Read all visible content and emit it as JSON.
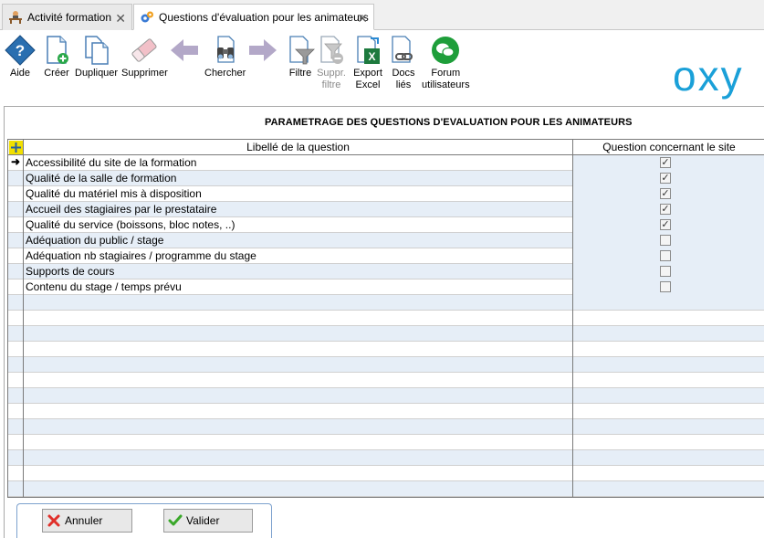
{
  "tabs": [
    {
      "label": "Activité formation",
      "icon": "classroom-icon",
      "active": false
    },
    {
      "label": "Questions d'évaluation pour les animateurs",
      "icon": "gears-icon",
      "active": true
    }
  ],
  "toolbar": {
    "aide": "Aide",
    "creer": "Créer",
    "dupliquer": "Dupliquer",
    "supprimer": "Supprimer",
    "chercher": "Chercher",
    "filtre": "Filtre",
    "suppr_filtre_1": "Suppr.",
    "suppr_filtre_2": "filtre",
    "export_1": "Export",
    "export_2": "Excel",
    "docs_1": "Docs",
    "docs_2": "liés",
    "forum_1": "Forum",
    "forum_2": "utilisateurs"
  },
  "logo": "oxy",
  "page_title": "PARAMETRAGE DES QUESTIONS D'EVALUATION POUR LES ANIMATEURS",
  "grid": {
    "columns": [
      "Libellé de la question",
      "Question concernant le site"
    ],
    "rows": [
      {
        "label": "Accessibilité du site de la formation",
        "checked": true,
        "current": true
      },
      {
        "label": "Qualité de la salle de formation",
        "checked": true
      },
      {
        "label": "Qualité du matériel mis à disposition",
        "checked": true
      },
      {
        "label": "Accueil des stagiaires par le prestataire",
        "checked": true
      },
      {
        "label": "Qualité du service (boissons, bloc notes, ..)",
        "checked": true
      },
      {
        "label": "Adéquation du public / stage",
        "checked": false
      },
      {
        "label": "Adéquation nb stagiaires / programme du stage",
        "checked": false
      },
      {
        "label": "Supports de cours",
        "checked": false
      },
      {
        "label": "Contenu du stage / temps prévu",
        "checked": false
      }
    ]
  },
  "buttons": {
    "annuler": "Annuler",
    "valider": "Valider"
  },
  "colors": {
    "accent": "#1aa0d8",
    "row_alt": "#e6eef7",
    "forum_green": "#1e9e3a",
    "help_blue": "#2a6fb0"
  }
}
